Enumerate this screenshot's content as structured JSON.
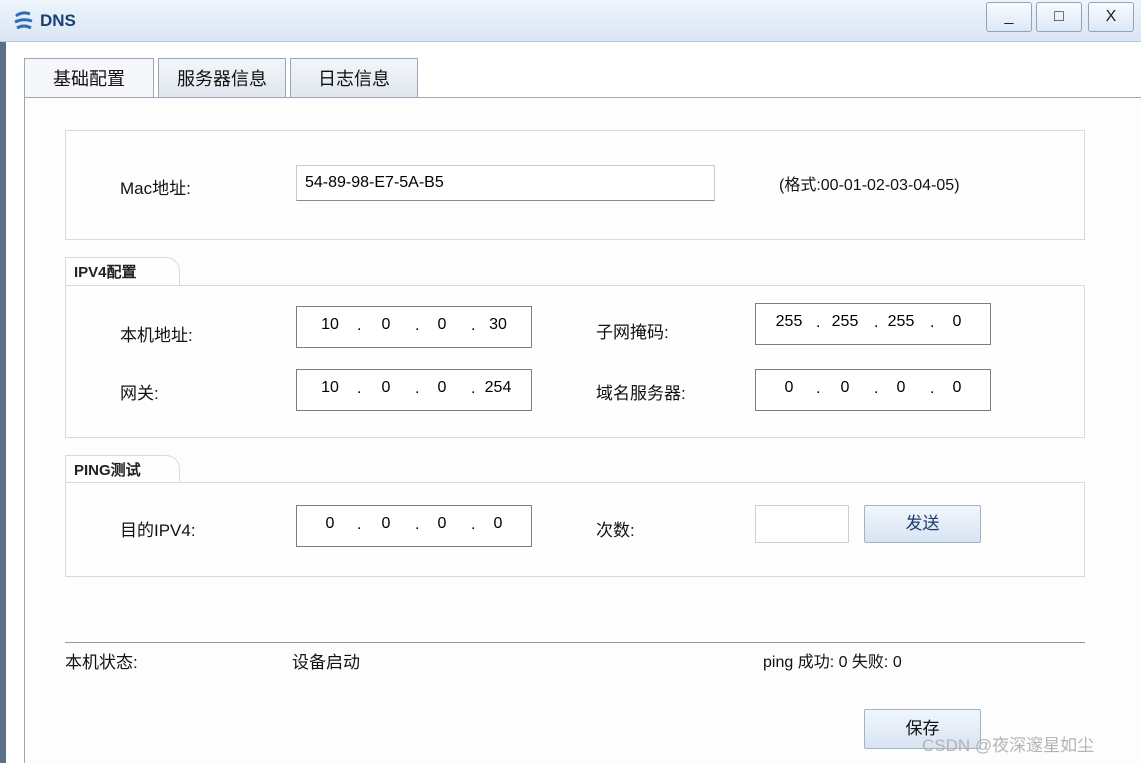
{
  "window": {
    "title": "DNS",
    "minimize": "_",
    "maximize": "□",
    "close": "X",
    "icon": "dns-app-icon"
  },
  "tabs": [
    {
      "label": "基础配置",
      "active": true
    },
    {
      "label": "服务器信息",
      "active": false
    },
    {
      "label": "日志信息",
      "active": false
    }
  ],
  "mac": {
    "label": "Mac地址:",
    "value": "54-89-98-E7-5A-B5",
    "format_hint": "(格式:00-01-02-03-04-05)"
  },
  "ipv4": {
    "legend": "IPV4配置",
    "local_ip_label": "本机地址:",
    "local_ip": [
      "10",
      "0",
      "0",
      "30"
    ],
    "subnet_label": "子网掩码:",
    "subnet": [
      "255",
      "255",
      "255",
      "0"
    ],
    "gateway_label": "网关:",
    "gateway": [
      "10",
      "0",
      "0",
      "254"
    ],
    "dns_label": "域名服务器:",
    "dns": [
      "0",
      "0",
      "0",
      "0"
    ]
  },
  "ping": {
    "legend": "PING测试",
    "dest_label": "目的IPV4:",
    "dest": [
      "0",
      "0",
      "0",
      "0"
    ],
    "count_label": "次数:",
    "count_value": "",
    "send_label": "发送"
  },
  "status": {
    "label": "本机状态:",
    "value": "设备启动",
    "ping_result": "ping 成功: 0 失败: 0"
  },
  "save_label": "保存",
  "watermark": "CSDN @夜深邃星如尘"
}
